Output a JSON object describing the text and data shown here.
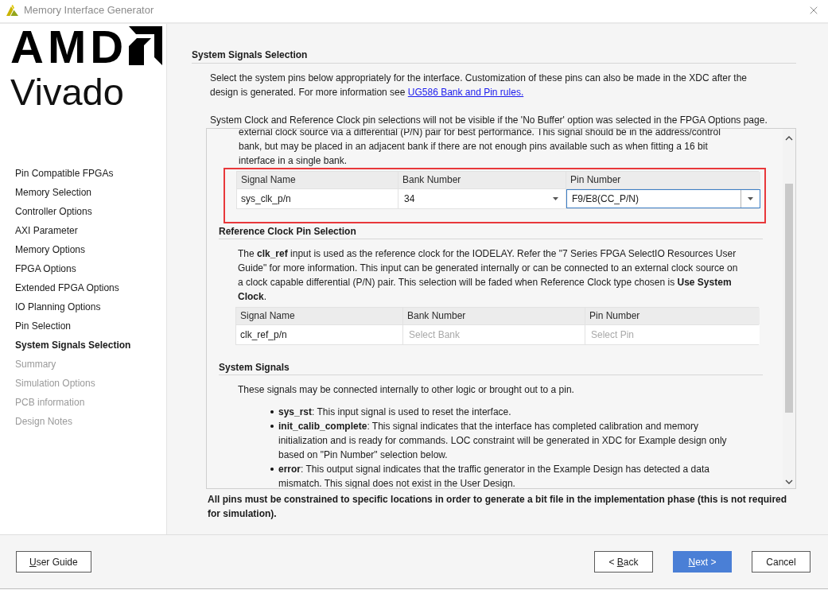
{
  "window": {
    "title": "Memory Interface Generator"
  },
  "logo": {
    "brand": "AMD",
    "product": "Vivado"
  },
  "sidebar": {
    "items": [
      {
        "label": "Pin Compatible FPGAs",
        "selected": false,
        "disabled": false
      },
      {
        "label": "Memory Selection",
        "selected": false,
        "disabled": false
      },
      {
        "label": "Controller Options",
        "selected": false,
        "disabled": false
      },
      {
        "label": "AXI Parameter",
        "selected": false,
        "disabled": false
      },
      {
        "label": "Memory Options",
        "selected": false,
        "disabled": false
      },
      {
        "label": "FPGA Options",
        "selected": false,
        "disabled": false
      },
      {
        "label": "Extended FPGA Options",
        "selected": false,
        "disabled": false
      },
      {
        "label": "IO Planning Options",
        "selected": false,
        "disabled": false
      },
      {
        "label": "Pin Selection",
        "selected": false,
        "disabled": false
      },
      {
        "label": "System Signals Selection",
        "selected": true,
        "disabled": false
      },
      {
        "label": "Summary",
        "selected": false,
        "disabled": true
      },
      {
        "label": "Simulation Options",
        "selected": false,
        "disabled": true
      },
      {
        "label": "PCB information",
        "selected": false,
        "disabled": true
      },
      {
        "label": "Design Notes",
        "selected": false,
        "disabled": true
      }
    ]
  },
  "page": {
    "title": "System Signals Selection",
    "intro": "Select the system pins below appropriately for the interface. Customization of these pins can also be made in the XDC after the design is generated. For more information see ",
    "intro_link": "UG586 Bank and Pin rules.",
    "notice": "System Clock and Reference Clock pin selections will not be visible if the 'No Buffer' option was selected in the FPGA Options page.",
    "panel": {
      "sections": [
        {
          "kind": "pins",
          "description": "external clock source via a differential (P/N) pair for best performance. This signal should be in the address/control bank, but may be placed in an adjacent bank if there are not enough pins available such as when fitting a 16 bit interface in a single bank.",
          "highlighted": true,
          "table": {
            "columns": [
              "Signal Name",
              "Bank Number",
              "Pin Number"
            ],
            "rows": [
              {
                "signal": "sys_clk_p/n",
                "bank": {
                  "value": "34",
                  "disabled": false,
                  "focused": false
                },
                "pin": {
                  "value": "F9/E8(CC_P/N)",
                  "disabled": false,
                  "focused": true
                }
              }
            ]
          }
        },
        {
          "kind": "pins",
          "heading": "Reference Clock Pin Selection",
          "description": "The **clk_ref** input is used as the reference clock for the IODELAY. Refer the \"7 Series FPGA SelectIO Resources User Guide\" for more information. This input can be generated internally or can be connected to an external clock source on a clock capable differential (P/N) pair. This selection will be faded when Reference Clock type chosen is **Use System Clock**.",
          "highlighted": false,
          "table": {
            "columns": [
              "Signal Name",
              "Bank Number",
              "Pin Number"
            ],
            "rows": [
              {
                "signal": "clk_ref_p/n",
                "bank": {
                  "placeholder": "Select Bank",
                  "disabled": true,
                  "focused": false
                },
                "pin": {
                  "placeholder": "Select Pin",
                  "disabled": true,
                  "focused": false
                }
              }
            ]
          }
        },
        {
          "kind": "signals",
          "heading": "System Signals",
          "description": "These signals may be connected internally to other logic or brought out to a pin.",
          "bullets": [
            "**sys_rst**: This input signal is used to reset the interface.",
            "**init_calib_complete**: This signal indicates that the interface has completed calibration and memory initialization and is ready for commands. LOC constraint will be generated in XDC for Example design only based on \"Pin Number\" selection below.",
            "**error**: This output signal indicates that the traffic generator in the Example Design has detected a data mismatch. This signal does not exist in the User Design."
          ]
        }
      ]
    },
    "note": "All pins must be constrained to specific locations in order to generate a bit file in the implementation phase (this is not required for simulation)."
  },
  "footer": {
    "left_buttons": [
      {
        "label": "User Guide",
        "access_key": true,
        "primary": false
      }
    ],
    "right_buttons": [
      {
        "label": "< Back",
        "access_key": true,
        "primary": false
      },
      {
        "label": "Next >",
        "access_key": true,
        "primary": true
      },
      {
        "label": "Cancel",
        "access_key": false,
        "primary": false
      }
    ]
  }
}
